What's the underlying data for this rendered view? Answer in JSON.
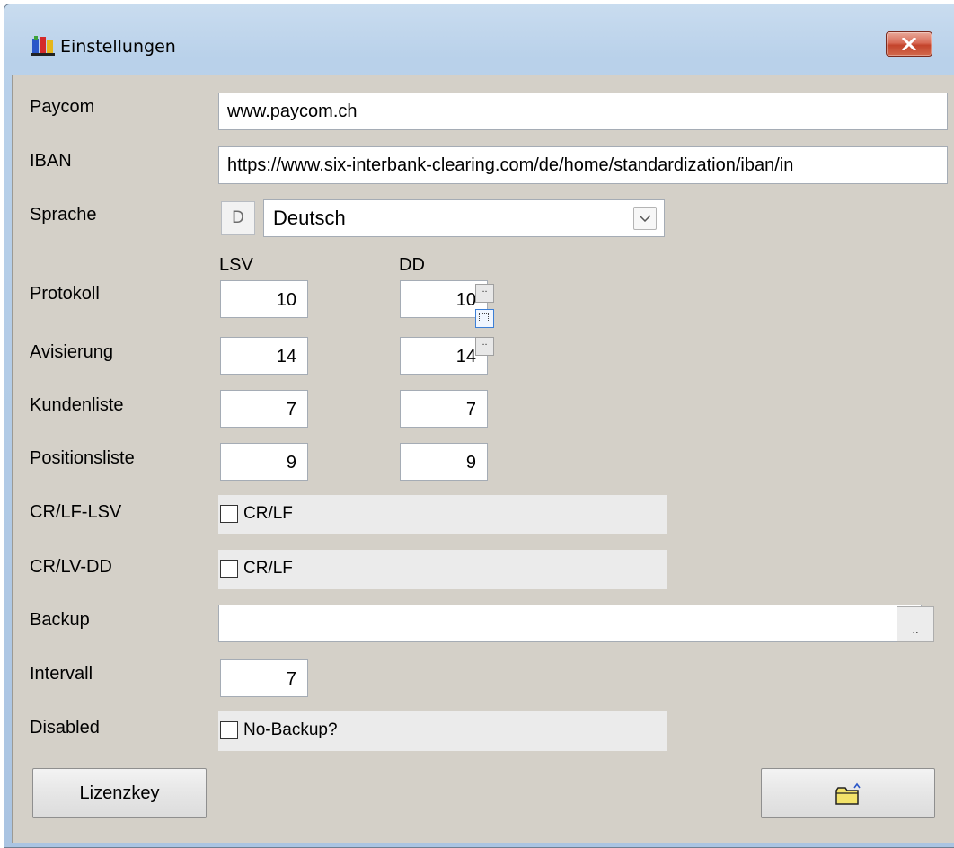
{
  "window": {
    "title": "Einstellungen",
    "icons": {
      "title": "app-icon",
      "close": "close-icon",
      "open": "open-folder-icon"
    }
  },
  "fields": {
    "paycom": {
      "label": "Paycom",
      "value": "www.paycom.ch"
    },
    "iban": {
      "label": "IBAN",
      "value": "https://www.six-interbank-clearing.com/de/home/standardization/iban/in"
    },
    "sprache": {
      "label": "Sprache",
      "code": "D",
      "selected": "Deutsch"
    },
    "columns": {
      "lsv": "LSV",
      "dd": "DD"
    },
    "protokoll": {
      "label": "Protokoll",
      "lsv": "10",
      "dd": "10"
    },
    "avisierung": {
      "label": "Avisierung",
      "lsv": "14",
      "dd": "14"
    },
    "kundenliste": {
      "label": "Kundenliste",
      "lsv": "7",
      "dd": "7"
    },
    "positionsliste": {
      "label": "Positionsliste",
      "lsv": "9",
      "dd": "9"
    },
    "crlf_lsv": {
      "label": "CR/LF-LSV",
      "checkbox_label": "CR/LF",
      "checked": false
    },
    "crlv_dd": {
      "label": "CR/LV-DD",
      "checkbox_label": "CR/LF",
      "checked": false
    },
    "backup": {
      "label": "Backup",
      "value": "",
      "browse": ".."
    },
    "intervall": {
      "label": "Intervall",
      "value": "7"
    },
    "disabled": {
      "label": "Disabled",
      "checkbox_label": "No-Backup?",
      "checked": false
    }
  },
  "spinner": {
    "up": "..",
    "down": ".."
  },
  "buttons": {
    "lizenzkey": "Lizenzkey"
  },
  "colors": {
    "dialog_bg": "#d4d0c8",
    "close_red": "#c3442c",
    "title_bar": "#b9d1ea"
  }
}
